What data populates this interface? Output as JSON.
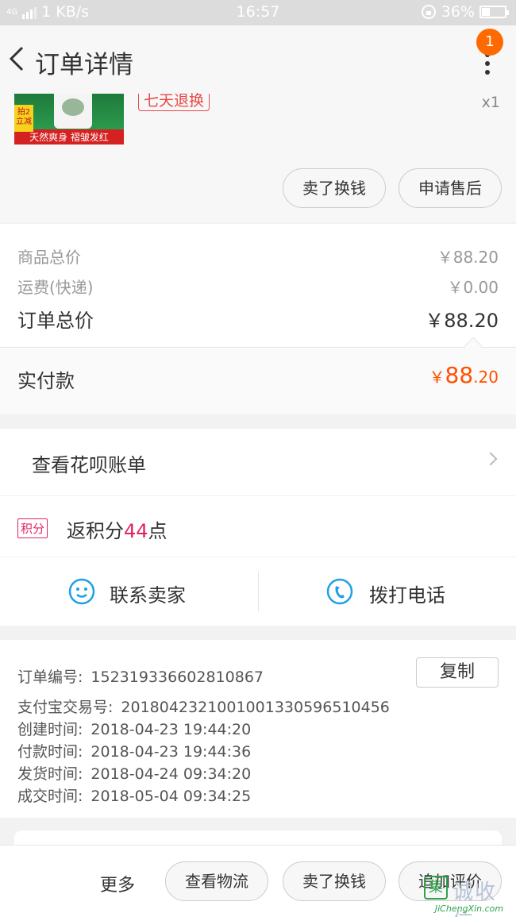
{
  "status_bar": {
    "network": "4G",
    "speed": "1 KB/s",
    "time": "16:57",
    "battery": "36%",
    "battery_level": 0.36
  },
  "header": {
    "title": "订单详情",
    "notification_count": "1"
  },
  "product": {
    "thumb_tag": "拍2 立减",
    "thumb_caption": "天然爽身 褶皱发红",
    "service_tag": "七天退换",
    "quantity": "x1",
    "buttons": {
      "sell": "卖了换钱",
      "after_sale": "申请售后"
    }
  },
  "prices": {
    "goods_total_label": "商品总价",
    "goods_total": "￥88.20",
    "shipping_label": "运费(快递)",
    "shipping": "￥0.00",
    "order_total_label": "订单总价",
    "order_total": "￥88.20",
    "paid_label": "实付款",
    "paid_currency": "￥",
    "paid_int": "88",
    "paid_dec": ".20"
  },
  "huabei": {
    "label": "查看花呗账单"
  },
  "points": {
    "badge": "积分",
    "prefix": "返积分",
    "value": "44",
    "suffix": "点"
  },
  "contact": {
    "seller": "联系卖家",
    "phone": "拨打电话"
  },
  "order_info": {
    "copy_label": "复制",
    "rows": [
      {
        "k": "订单编号:",
        "v": "152319336602810867"
      },
      {
        "k": "支付宝交易号:",
        "v": "2018042321001001330596510456"
      },
      {
        "k": "创建时间:",
        "v": "2018-04-23 19:44:20"
      },
      {
        "k": "付款时间:",
        "v": "2018-04-23 19:44:36"
      },
      {
        "k": "发货时间:",
        "v": "2018-04-24 09:34:20"
      },
      {
        "k": "成交时间:",
        "v": "2018-05-04 09:34:25"
      }
    ]
  },
  "bottom_bar": {
    "more": "更多",
    "logistics": "查看物流",
    "sell": "卖了换钱",
    "review": "追加评价"
  },
  "watermark": {
    "icon": "集",
    "cn": "诚收信",
    "en": "JiChengXin.com"
  },
  "colors": {
    "accent_orange": "#ff5000",
    "badge_orange": "#ff6a00",
    "points_pink": "#e0245e",
    "contact_blue": "#1e9fe8"
  }
}
